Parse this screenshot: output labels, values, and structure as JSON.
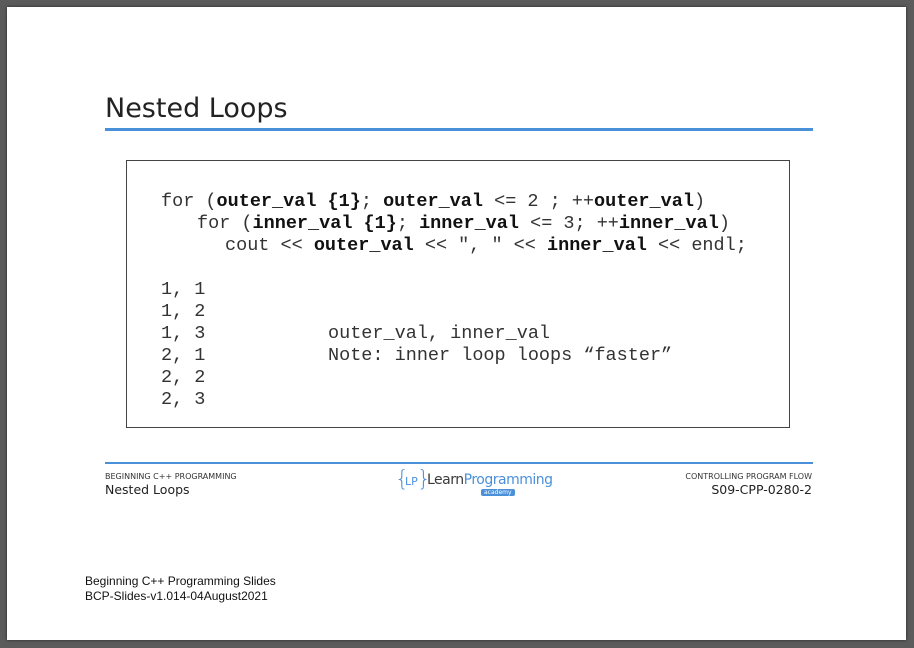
{
  "slide": {
    "title": "Nested Loops"
  },
  "code": {
    "line1": {
      "p1": "for (",
      "b1": "outer_val {1}",
      "p2": "; ",
      "b2": "outer_val",
      "p3": " <= 2 ; ++",
      "b3": "outer_val",
      "p4": ")"
    },
    "line2": {
      "p1": "for (",
      "b1": "inner_val {1}",
      "p2": "; ",
      "b2": "inner_val",
      "p3": " <= 3; ++",
      "b3": "inner_val",
      "p4": ")"
    },
    "line3": {
      "p1": "cout << ",
      "b1": "outer_val",
      "p2": " << \", \" << ",
      "b2": "inner_val",
      "p3": " << endl;"
    }
  },
  "output": {
    "lines": [
      "1, 1",
      "1, 2",
      "1, 3",
      "2, 1",
      "2, 2",
      "2, 3"
    ],
    "note_line1": "outer_val, inner_val",
    "note_line2": "Note: inner loop loops “faster”"
  },
  "footer": {
    "left_small": "BEGINNING C++ PROGRAMMING",
    "left_big": "Nested Loops",
    "right_small": "CONTROLLING PROGRAM FLOW",
    "right_big": "S09-CPP-0280-2",
    "logo": {
      "brace_open": "{",
      "initials": "LP",
      "brace_close": "}",
      "word1": "Learn",
      "word2": "Programming",
      "tag": "academy"
    }
  },
  "document": {
    "note_line1": "Beginning C++ Programming Slides",
    "note_line2": "BCP-Slides-v1.014-04August2021"
  },
  "colors": {
    "accent": "#4a90d9",
    "frame": "#5b5b5b"
  }
}
